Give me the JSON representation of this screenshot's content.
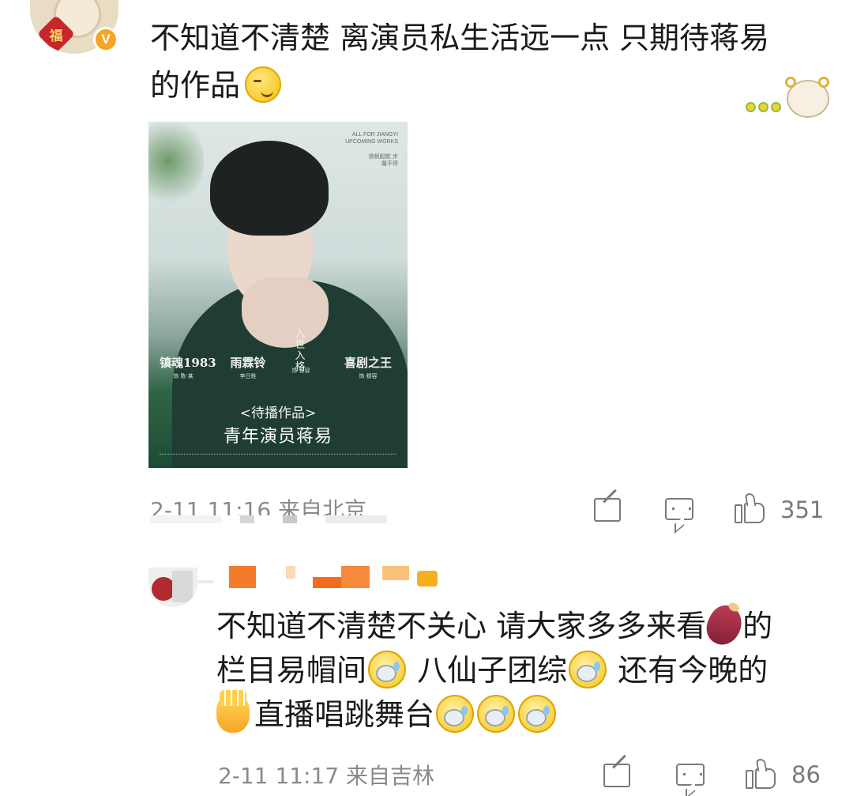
{
  "comment1": {
    "badge": "V",
    "avatar_fu": "福",
    "text_line1": "不知道不清楚 离演员私生活远一点 只期待蒋易",
    "text_line2": "的作品",
    "emoji": "smirk-icon",
    "sticker": "sheep-flowers-sticker",
    "photo": {
      "header_en": "ALL FOR JIANGYI UPCOMING WORKS",
      "header_cn": "扬帆起航 步履不停",
      "works": [
        {
          "title": "镇魂1983",
          "sub": "饰 陈·某"
        },
        {
          "title": "雨霖铃",
          "sub": "李日鉎"
        },
        {
          "title": "入世入格",
          "sub": "饰 穆容"
        },
        {
          "title": "喜剧之王",
          "sub": "饰 穆容"
        }
      ],
      "tag": "<待播作品>",
      "caption": "青年演员蒋易"
    },
    "meta": "2-11 11:16 来自北京",
    "likes": "351",
    "colors": {
      "badge": "#f5a623",
      "text": "#1a1a1a",
      "meta": "#8a8a8a"
    }
  },
  "comment2": {
    "username_blur_colors": [
      "#f47b2a",
      "#f9c27b",
      "#f36b1e",
      "#f68a3a",
      "#f5b020"
    ],
    "text_line1": "不知道不清楚不关心 请大家多多来看",
    "text_line1_tail": "的",
    "text_line2_a": "栏目易帽间",
    "text_line2_b": " 八仙子团综",
    "text_line2_c": " 还有今晚的",
    "text_line3": "直播唱跳舞台",
    "meta": "2-11 11:17 来自吉林",
    "likes": "86"
  }
}
